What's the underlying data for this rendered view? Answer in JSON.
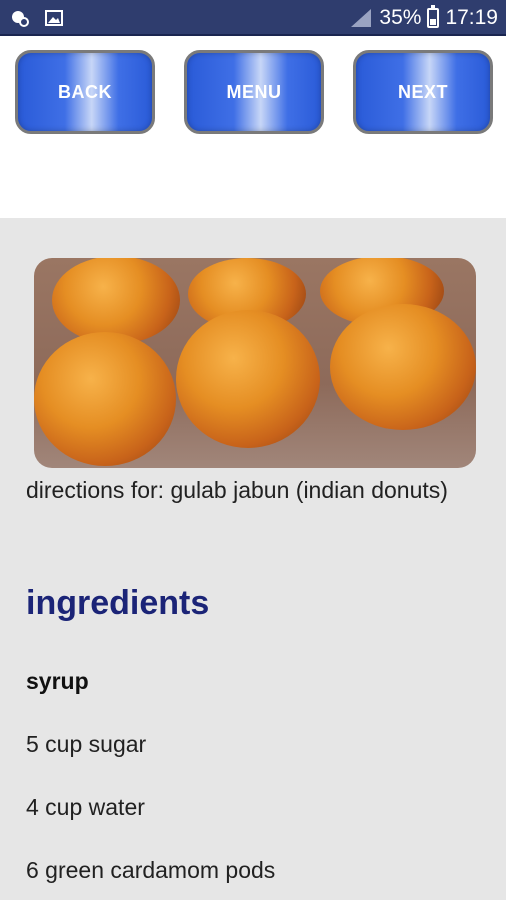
{
  "status_bar": {
    "battery_percent": "35%",
    "time": "17:19",
    "battery_level": 0.35,
    "icons": [
      "notification-icon",
      "gallery-icon",
      "signal-icon",
      "battery-icon"
    ]
  },
  "nav": {
    "back_label": "BACK",
    "menu_label": "MENU",
    "next_label": "NEXT"
  },
  "recipe": {
    "directions_text": "directions for: gulab jabun (indian donuts)",
    "ingredients_heading": "ingredients",
    "subsection": "syrup",
    "ingredients": [
      "5 cup sugar",
      "4 cup water",
      "6 green cardamom pods"
    ]
  },
  "colors": {
    "status_bar": "#2f3d6e",
    "button_blue": "#2a5bd8",
    "heading": "#1b2477",
    "content_bg": "#e6e6e6"
  }
}
